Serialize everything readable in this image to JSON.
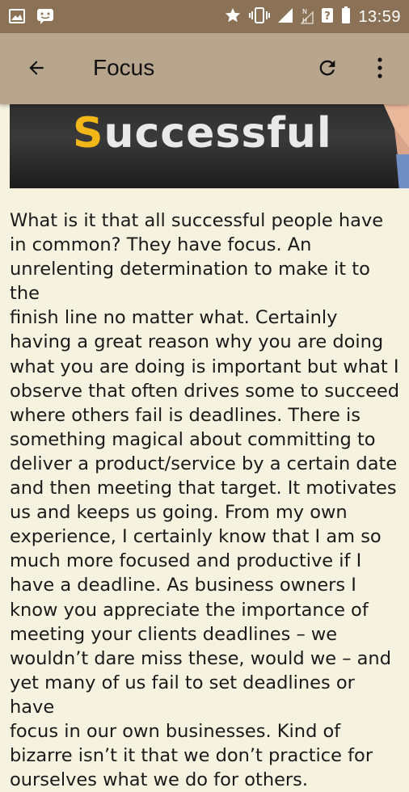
{
  "statusbar": {
    "time": "13:59",
    "left_icons": [
      "image-notification-icon",
      "chat-notification-icon"
    ],
    "right_icons": [
      "star-icon",
      "vibrate-icon",
      "signal-icon",
      "no-signal-icon",
      "unknown-network-icon",
      "battery-icon"
    ]
  },
  "appbar": {
    "title": "Focus",
    "back_icon": "arrow-back-icon",
    "refresh_icon": "refresh-icon",
    "more_icon": "more-vert-icon"
  },
  "banner": {
    "word_first": "S",
    "word_rest": "uccessful"
  },
  "article": {
    "text": "What is it that all successful people have\nin common?  They have focus.  An\nunrelenting determination to make it to the\nfinish line no matter what.  Certainly\nhaving a great reason why you are doing\nwhat you are doing is important but what I\nobserve that often drives some to succeed\nwhere others fail is deadlines.  There is\nsomething magical about committing to\ndeliver a product/service by a certain date\nand then meeting that target.  It motivates\nus and keeps us going.  From my own\nexperience, I certainly know that I am so\nmuch more focused and productive if I\nhave a deadline.  As business owners I\nknow you appreciate the importance of\nmeeting your clients deadlines – we\nwouldn’t dare miss these, would we – and\nyet many of us fail to set deadlines or have\nfocus in our own businesses.  Kind of\nbizarre isn’t it that we don’t practice for\nourselves what we do for others."
  },
  "colors": {
    "statusbar": "#8b7257",
    "appbar": "#b8a58e",
    "background": "#f5f3df",
    "banner_accent": "#f2b619"
  }
}
